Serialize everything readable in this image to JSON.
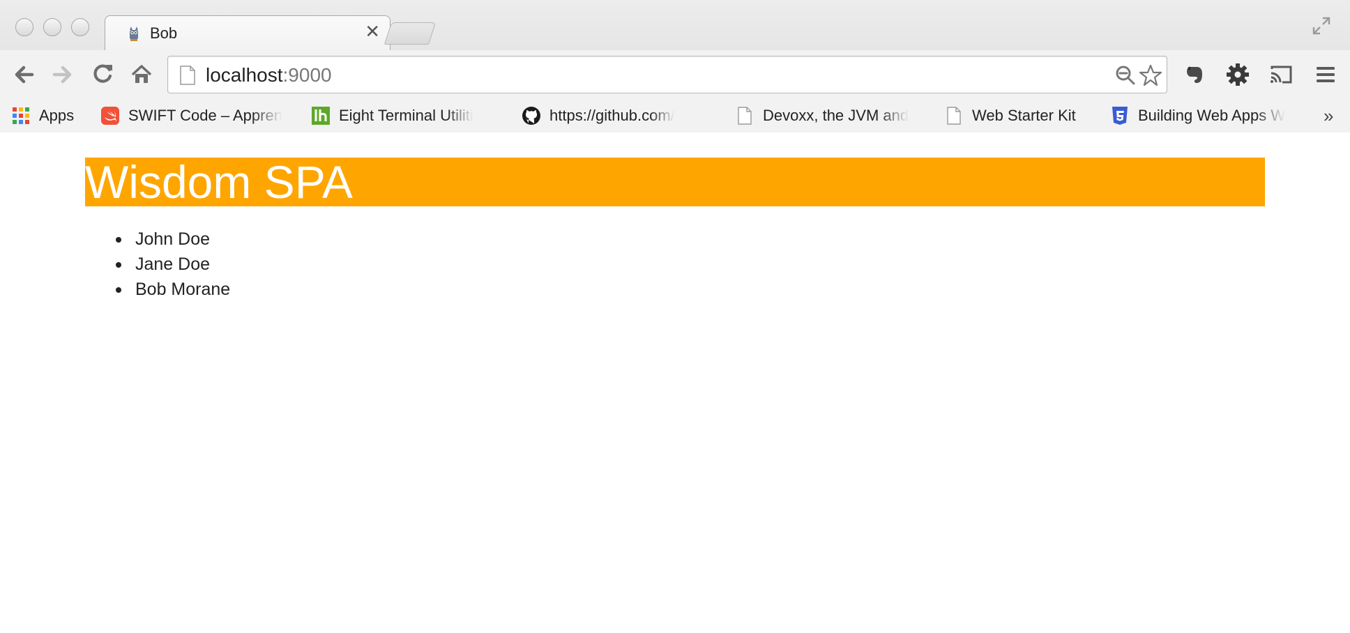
{
  "window": {
    "tab_title": "Bob",
    "close_glyph": "✕"
  },
  "toolbar": {
    "url_host": "localhost",
    "url_port": ":9000"
  },
  "bookmarks": [
    {
      "label": "Apps",
      "icon": "apps-grid-icon"
    },
    {
      "label": "SWIFT Code – Appren",
      "icon": "swift-icon"
    },
    {
      "label": "Eight Terminal Utiliti",
      "icon": "lh-icon"
    },
    {
      "label": "https://github.com/",
      "icon": "github-icon"
    },
    {
      "label": "Devoxx, the JVM and",
      "icon": "page-icon"
    },
    {
      "label": "Web Starter Kit",
      "icon": "page-icon"
    },
    {
      "label": "Building Web Apps W",
      "icon": "html5-icon"
    }
  ],
  "bookmarks_overflow": "»",
  "page": {
    "heading": "Wisdom SPA",
    "heading_bg": "#ffa500",
    "people": [
      "John Doe",
      "Jane Doe",
      "Bob Morane"
    ]
  }
}
